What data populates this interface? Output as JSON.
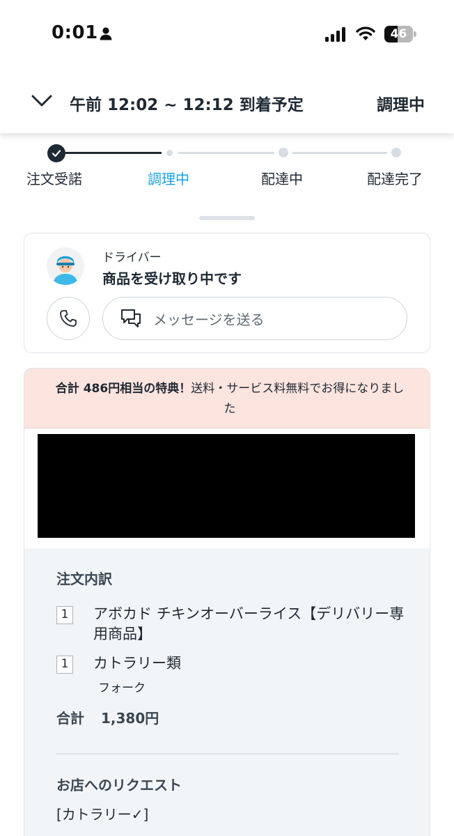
{
  "status_bar": {
    "time": "0:01",
    "battery": "46",
    "battery_level": 0.46,
    "icons": [
      "person-icon",
      "signal-icon",
      "wifi-icon",
      "battery-icon"
    ]
  },
  "header": {
    "eta": "午前 12:02 ~ 12:12 到着予定",
    "status": "調理中",
    "icon": "chevron-down-icon"
  },
  "progress": {
    "steps": [
      {
        "label": "注文受諾",
        "state": "done"
      },
      {
        "label": "調理中",
        "state": "current"
      },
      {
        "label": "配達中",
        "state": "pending"
      },
      {
        "label": "配達完了",
        "state": "pending"
      }
    ],
    "colors": {
      "active": "#1f2933",
      "current_label": "#1aa1e0",
      "inactive": "#d7dde2"
    }
  },
  "driver": {
    "role": "ドライバー",
    "status": "商品を受け取り中です",
    "call_icon": "phone-icon",
    "message_icon": "message-icon",
    "message_label": "メッセージを送る"
  },
  "promo": {
    "bold": "合計 486円相当の特典！",
    "text": "送料・サービス料無料でお得になりました",
    "background": "#fce4df"
  },
  "order": {
    "title": "注文内訳",
    "items": [
      {
        "qty": "1",
        "name": "アボカド チキンオーバーライス【デリバリー専用商品】"
      },
      {
        "qty": "1",
        "name": "カトラリー類",
        "option": "フォーク"
      }
    ],
    "total_label": "合計",
    "total_value": "1,380円",
    "request_title": "お店へのリクエスト",
    "request_text": "[カトラリー✓]"
  }
}
